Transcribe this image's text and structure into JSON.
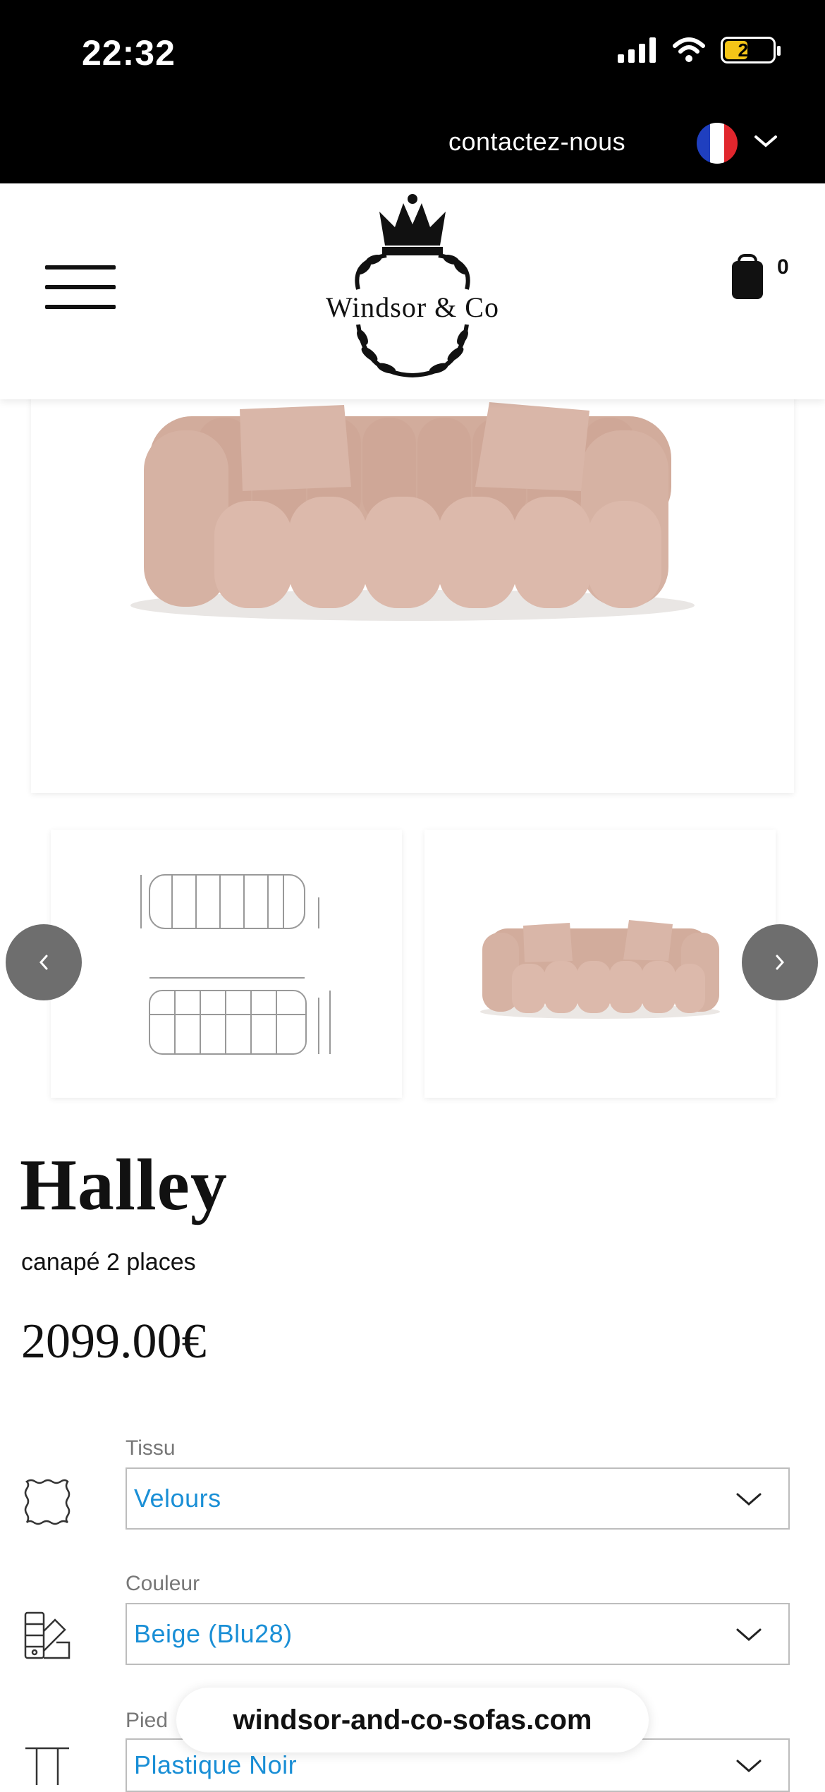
{
  "status_bar": {
    "time": "22:32",
    "battery": "20"
  },
  "topbar": {
    "contact_label": "contactez-nous",
    "language_flag": "fr-flag-icon"
  },
  "header": {
    "logo_text": "Windsor & Co",
    "cart_count": "0"
  },
  "product": {
    "title": "Halley",
    "subtitle": "canapé 2 places",
    "price": "2099.00€"
  },
  "options": [
    {
      "label": "Tissu",
      "value": "Velours",
      "icon": "fabric-swatch-icon"
    },
    {
      "label": "Couleur",
      "value": "Beige (Blu28)",
      "icon": "color-palette-icon"
    },
    {
      "label": "Pied",
      "value": "Plastique Noir",
      "icon": "sofa-leg-icon"
    }
  ],
  "browser": {
    "url": "windsor-and-co-sofas.com"
  },
  "colors": {
    "sofa": "#d9b6a8",
    "link": "#1a8fd6",
    "topbar": "#000000"
  }
}
